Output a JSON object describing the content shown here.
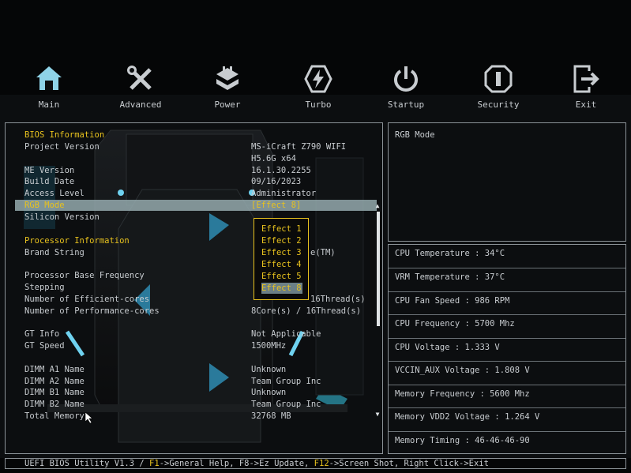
{
  "nav": [
    {
      "label": "Main",
      "icon": "home-icon",
      "active": true
    },
    {
      "label": "Advanced",
      "icon": "tools-icon"
    },
    {
      "label": "Power",
      "icon": "power-chip-icon"
    },
    {
      "label": "Turbo",
      "icon": "lightning-icon"
    },
    {
      "label": "Startup",
      "icon": "power-button-icon"
    },
    {
      "label": "Security",
      "icon": "security-icon"
    },
    {
      "label": "Exit",
      "icon": "exit-icon"
    }
  ],
  "main": {
    "bios_info_title": "BIOS Information",
    "project_version_label": "Project Version",
    "project_version_value1": "MS-iCraft Z790 WIFI",
    "project_version_value2": "H5.6G x64",
    "me_version_label": "ME Version",
    "me_version_value": "16.1.30.2255",
    "build_date_label": "Build Date",
    "build_date_value": "09/16/2023",
    "access_level_label": "Access Level",
    "access_level_value": "Administrator",
    "rgb_mode_label": "RGB Mode",
    "rgb_mode_value": "[Effect 8]",
    "silicon_version_label": "Silicon Version",
    "processor_info_title": "Processor Information",
    "brand_string_label": "Brand String",
    "brand_string_value": "e(TM)",
    "base_freq_label": "Processor Base Frequency",
    "stepping_label": "Stepping",
    "efficient_cores_label": "Number of Efficient-cores",
    "efficient_cores_value": "16Thread(s)",
    "performance_cores_label": "Number of Performance-cores",
    "performance_cores_value": "8Core(s) / 16Thread(s)",
    "gt_info_label": "GT Info",
    "gt_info_value": "Not Applicable",
    "gt_speed_label": "GT Speed",
    "gt_speed_value": "1500MHz",
    "dimm_a1_label": "DIMM A1 Name",
    "dimm_a1_value": "Unknown",
    "dimm_a2_label": "DIMM A2 Name",
    "dimm_a2_value": "Team Group Inc",
    "dimm_b1_label": "DIMM B1 Name",
    "dimm_b1_value": "Unknown",
    "dimm_b2_label": "DIMM B2 Name",
    "dimm_b2_value": "Team Group Inc",
    "total_memory_label": "Total Memory",
    "total_memory_value": "32768 MB"
  },
  "popup": {
    "options": [
      "Effect 1",
      "Effect 2",
      "Effect 3",
      "Effect 4",
      "Effect 5",
      "Effect 8"
    ],
    "selected": "Effect 8"
  },
  "help": {
    "text": "RGB Mode"
  },
  "hw_monitor": [
    "CPU Temperature : 34°C",
    "VRM Temperature : 37°C",
    "CPU Fan Speed : 986 RPM",
    "CPU Frequency : 5700 Mhz",
    "CPU Voltage : 1.333 V",
    "VCCIN_AUX Voltage : 1.808 V",
    "Memory Frequency : 5600 Mhz",
    "Memory VDD2 Voltage : 1.264 V",
    "Memory Timing : 46-46-46-90"
  ],
  "footer": {
    "prefix": "UEFI BIOS Utility V1.3 / ",
    "f1": "F1",
    "f1_text": "->General Help, F8->Ez Update, ",
    "f12": "F12",
    "f12_text": "->Screen Shot, Right Click->Exit"
  },
  "colors": {
    "accent": "#e8c21e",
    "highlight": "#94a9ad",
    "icon": "#c8ccd0",
    "nav_active": "#8fd3e8"
  }
}
